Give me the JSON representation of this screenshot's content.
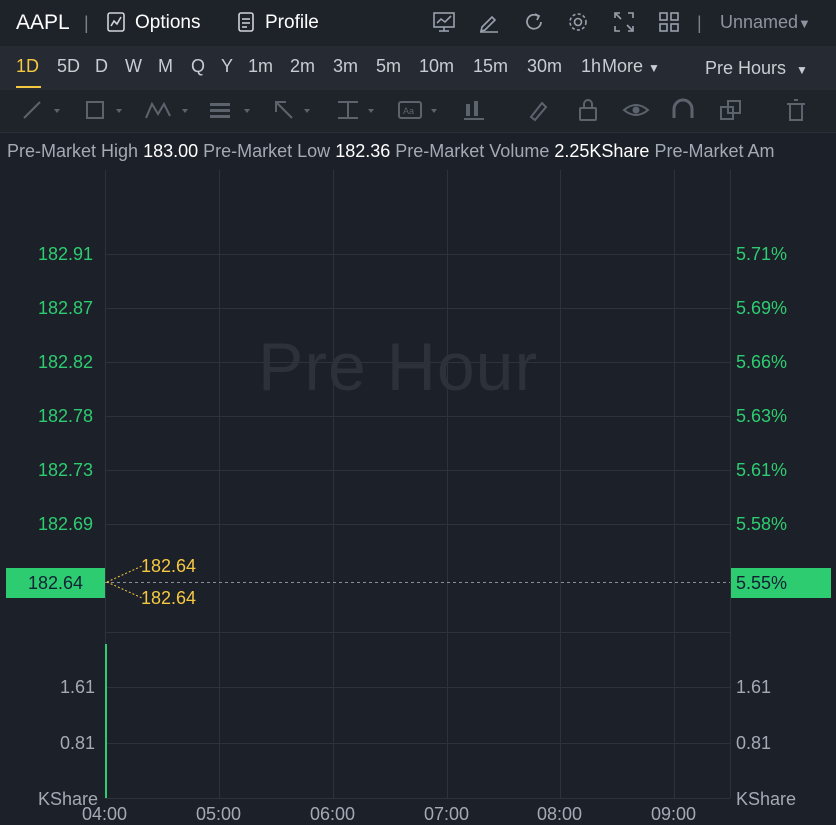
{
  "header": {
    "symbol": "AAPL",
    "separator": "|",
    "options_label": "Options",
    "profile_label": "Profile",
    "workspace_label": "Unnamed"
  },
  "intervals": [
    "1D",
    "5D",
    "D",
    "W",
    "M",
    "Q",
    "Y",
    "1m",
    "2m",
    "3m",
    "5m",
    "10m",
    "15m",
    "30m",
    "1h"
  ],
  "active_interval": "1D",
  "more_label": "More",
  "session_label": "Pre Hours",
  "info": {
    "high_label": "Pre-Market High",
    "high_value": "183.00",
    "low_label": "Pre-Market Low",
    "low_value": "182.36",
    "volume_label": "Pre-Market Volume",
    "volume_value": "2.25KShare",
    "amount_label": "Pre-Market Am"
  },
  "watermark": "Pre Hour",
  "price_axis_left": [
    "182.91",
    "182.87",
    "182.82",
    "182.78",
    "182.73",
    "182.69"
  ],
  "price_axis_right": [
    "5.71%",
    "5.69%",
    "5.66%",
    "5.63%",
    "5.61%",
    "5.58%"
  ],
  "current_price": "182.64",
  "current_change": "5.55%",
  "annotations": [
    "182.64",
    "182.64"
  ],
  "volume_axis_left": [
    "1.61",
    "0.81"
  ],
  "volume_axis_right": [
    "1.61",
    "0.81"
  ],
  "volume_unit": "KShare",
  "time_labels": [
    "04:00",
    "05:00",
    "06:00",
    "07:00",
    "08:00",
    "09:00"
  ],
  "colors": {
    "up": "#2ecc71",
    "accent": "#f5c842",
    "background": "#1c2028"
  }
}
